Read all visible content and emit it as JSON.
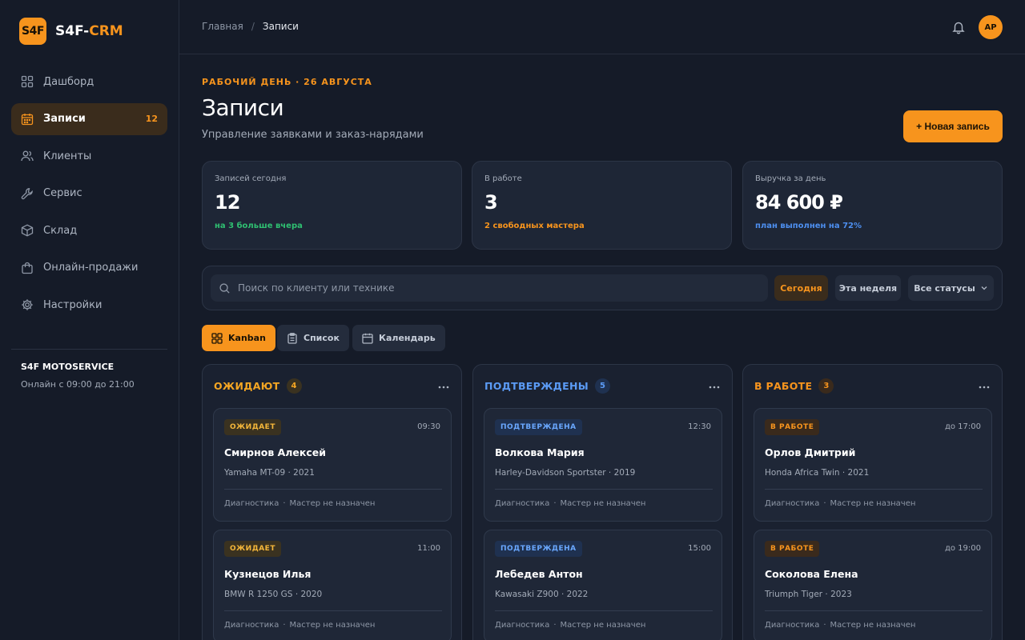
{
  "app": {
    "logo_badge": "S4F",
    "name_a": "S4F-",
    "name_b": "CRM"
  },
  "sidebar": {
    "items": [
      {
        "label": "Дашборд",
        "icon": "dashboard-icon",
        "active": false
      },
      {
        "label": "Записи",
        "icon": "calendar-icon",
        "active": true,
        "count": "12"
      },
      {
        "label": "Клиенты",
        "icon": "users-icon",
        "active": false
      },
      {
        "label": "Сервис",
        "icon": "wrench-icon",
        "active": false
      },
      {
        "label": "Склад",
        "icon": "box-icon",
        "active": false
      },
      {
        "label": "Онлайн-продажи",
        "icon": "shopping-bag-icon",
        "active": false
      },
      {
        "label": "Настройки",
        "icon": "gear-icon",
        "active": false
      }
    ],
    "shop_name": "S4F MOTOSERVICE",
    "shop_hours": "Онлайн с 09:00 до 21:00"
  },
  "topbar": {
    "breadcrumb_home": "Главная",
    "breadcrumb_sep": "/",
    "breadcrumb_current": "Записи",
    "avatar_initials": "AP"
  },
  "header": {
    "eyebrow": "РАБОЧИЙ ДЕНЬ · 26 АВГУСТА",
    "title": "Записи",
    "subtitle": "Управление заявками и заказ-нарядами",
    "new_button": "+ Новая запись"
  },
  "stats": [
    {
      "label": "Записей сегодня",
      "value": "12",
      "note": "на 3 больше вчера",
      "note_color": "#2fbf71"
    },
    {
      "label": "В работе",
      "value": "3",
      "note": "2 свободных мастера",
      "note_color": "#f7941d"
    },
    {
      "label": "Выручка за день",
      "value": "84 600 ₽",
      "note": "план выполнен на 72%",
      "note_color": "#4d8ff0"
    }
  ],
  "filters": {
    "search_placeholder": "Поиск по клиенту или технике",
    "today": "Сегодня",
    "week": "Эта неделя",
    "status": "Все статусы"
  },
  "views": {
    "kanban": "Kanban",
    "list": "Список",
    "calendar": "Календарь"
  },
  "columns": [
    {
      "title": "ОЖИДАЮТ",
      "count": "4",
      "color": "#f5a623",
      "count_bg": "#3a3220",
      "cards": [
        {
          "badge": "ОЖИДАЕТ",
          "time": "09:30",
          "name": "Смирнов Алексей",
          "bike": "Yamaha MT-09 · 2021",
          "service": "Диагностика",
          "dot": "·",
          "master": "Мастер не назначен"
        },
        {
          "badge": "ОЖИДАЕТ",
          "time": "11:00",
          "name": "Кузнецов Илья",
          "bike": "BMW R 1250 GS · 2020",
          "service": "Диагностика",
          "dot": "·",
          "master": "Мастер не назначен"
        }
      ]
    },
    {
      "title": "ПОДТВЕРЖДЕНЫ",
      "count": "5",
      "color": "#5b9bf5",
      "count_bg": "#1f3150",
      "cards": [
        {
          "badge": "ПОДТВЕРЖДЕНА",
          "time": "12:30",
          "name": "Волкова Мария",
          "bike": "Harley-Davidson Sportster · 2019",
          "service": "Диагностика",
          "dot": "·",
          "master": "Мастер не назначен"
        },
        {
          "badge": "ПОДТВЕРЖДЕНА",
          "time": "15:00",
          "name": "Лебедев Антон",
          "bike": "Kawasaki Z900 · 2022",
          "service": "Диагностика",
          "dot": "·",
          "master": "Мастер не назначен"
        }
      ]
    },
    {
      "title": "В РАБОТЕ",
      "count": "3",
      "color": "#f7941d",
      "count_bg": "#3a2a1c",
      "cards": [
        {
          "badge": "В РАБОТЕ",
          "time": "до 17:00",
          "name": "Орлов Дмитрий",
          "bike": "Honda Africa Twin · 2021",
          "service": "Диагностика",
          "dot": "·",
          "master": "Мастер не назначен"
        },
        {
          "badge": "В РАБОТЕ",
          "time": "до 19:00",
          "name": "Соколова Елена",
          "bike": "Triumph Tiger · 2023",
          "service": "Диагностика",
          "dot": "·",
          "master": "Мастер не назначен"
        }
      ]
    }
  ],
  "colors": {
    "accent": "#f7941d",
    "background": "#151b28",
    "panel": "#1e2636"
  }
}
